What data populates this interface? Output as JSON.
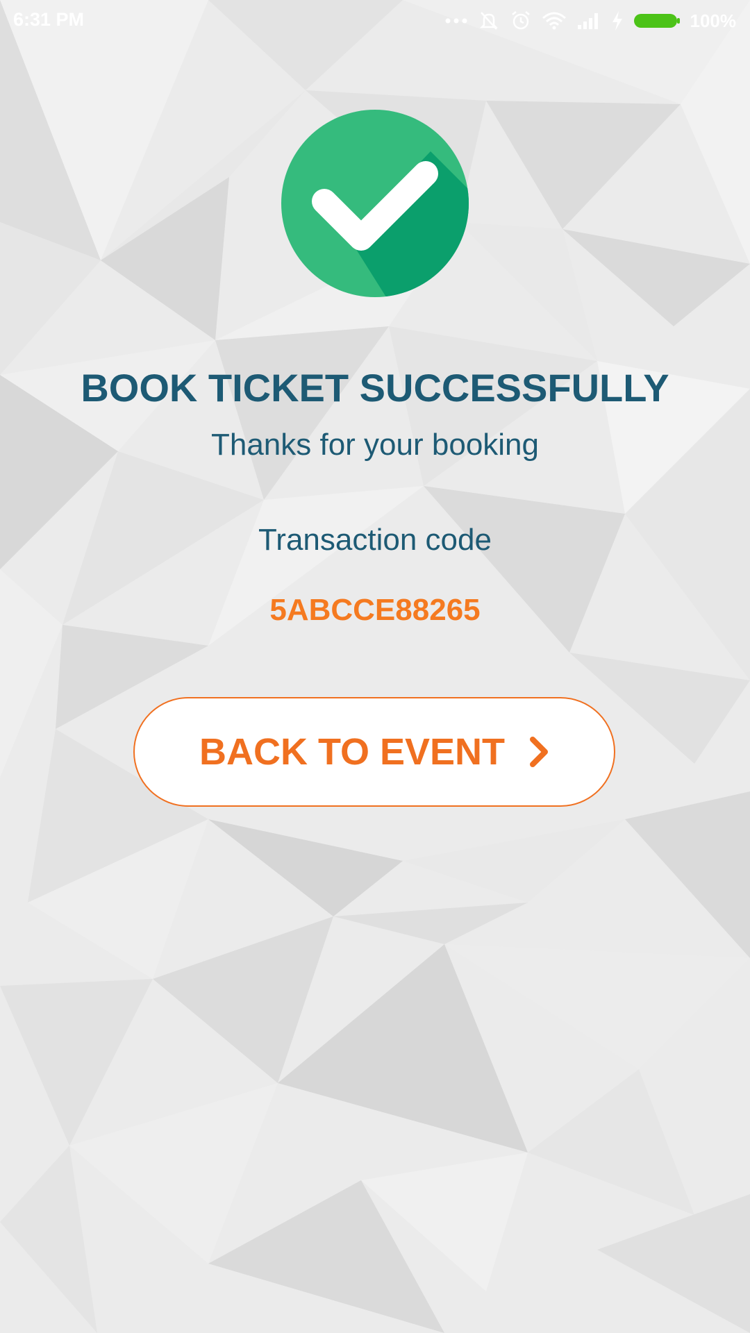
{
  "status_bar": {
    "time": "6:31 PM",
    "battery": "100%",
    "icons": [
      "more-dots-icon",
      "mute-vibrate-icon",
      "alarm-clock-icon",
      "wifi-icon",
      "signal-icon",
      "charging-bolt-icon",
      "battery-icon"
    ],
    "battery_color": "#4cc318"
  },
  "success": {
    "icon": "checkmark-circle-icon",
    "icon_color": "#35bb7d",
    "icon_shadow_color": "#0b9f6c",
    "title": "BOOK TICKET SUCCESSFULLY",
    "subtitle": "Thanks for your booking"
  },
  "transaction": {
    "label": "Transaction code",
    "code": "5ABCCE88265"
  },
  "actions": {
    "back_label": "BACK TO EVENT",
    "back_icon": "chevron-right-icon",
    "accent_color": "#f07020"
  },
  "theme": {
    "text_color": "#1d5a74",
    "background": "#ececec"
  }
}
